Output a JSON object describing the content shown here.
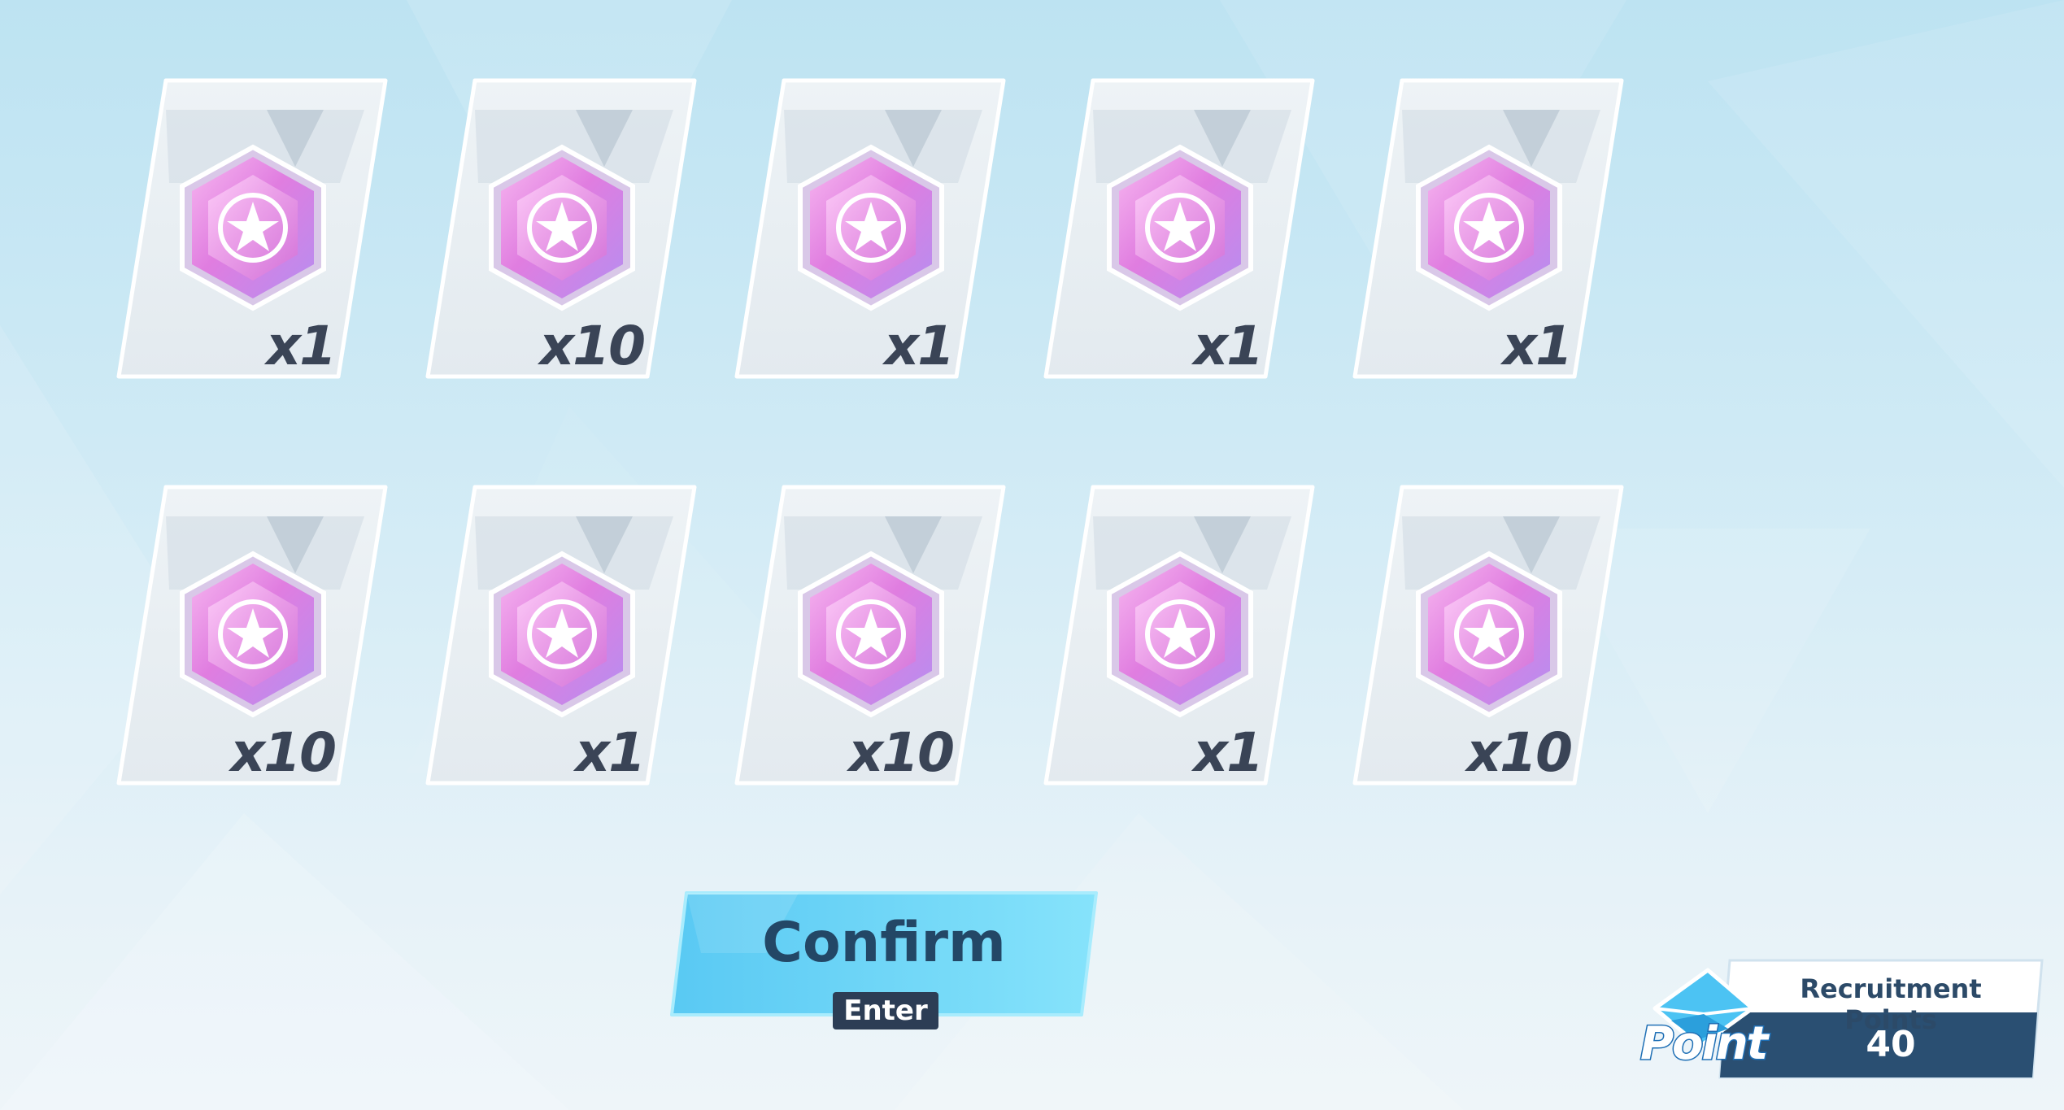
{
  "rewards": [
    {
      "item": "pyroxene-gem",
      "quantity": "x1"
    },
    {
      "item": "pyroxene-gem",
      "quantity": "x10"
    },
    {
      "item": "pyroxene-gem",
      "quantity": "x1"
    },
    {
      "item": "pyroxene-gem",
      "quantity": "x1"
    },
    {
      "item": "pyroxene-gem",
      "quantity": "x1"
    },
    {
      "item": "pyroxene-gem",
      "quantity": "x10"
    },
    {
      "item": "pyroxene-gem",
      "quantity": "x1"
    },
    {
      "item": "pyroxene-gem",
      "quantity": "x10"
    },
    {
      "item": "pyroxene-gem",
      "quantity": "x1"
    },
    {
      "item": "pyroxene-gem",
      "quantity": "x10"
    }
  ],
  "confirm": {
    "label": "Confirm",
    "key_hint": "Enter"
  },
  "recruitment_points": {
    "icon_word": "Point",
    "label": "Recruitment Points",
    "value": "40"
  },
  "colors": {
    "confirm_button": "#6fd6f7",
    "quantity_text": "#3a4456",
    "points_panel": "#2a4f72",
    "gem": "#e58fe0"
  },
  "icons": {
    "gem": "hexagon-gem-icon",
    "point": "envelope-icon"
  }
}
